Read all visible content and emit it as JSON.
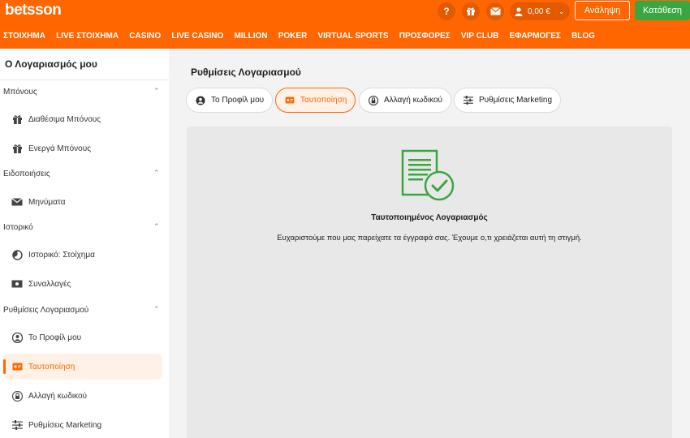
{
  "header": {
    "logo": "betsson",
    "help_icon": "?",
    "balance": "0,00 €",
    "login_label": "Ανάληψη",
    "register_label": "Κατάθεση"
  },
  "nav": [
    "ΣΤΟΙΧΗΜΑ",
    "LIVE ΣΤΟΙΧΗΜΑ",
    "CASINO",
    "LIVE CASINO",
    "MILLION",
    "POKER",
    "VIRTUAL SPORTS",
    "ΠΡΟΣΦΟΡΕΣ",
    "VIP CLUB",
    "ΕΦΑΡΜΟΓΕΣ",
    "BLOG"
  ],
  "sidebar": {
    "title": "Ο Λογαριασμός μου",
    "sections": [
      {
        "label": "Μπόνους",
        "items": [
          {
            "label": "Διαθέσιμα Μπόνους",
            "icon": "gift-icon"
          },
          {
            "label": "Ενεργά Μπόνους",
            "icon": "gift-icon"
          }
        ]
      },
      {
        "label": "Ειδοποιήσεις",
        "items": [
          {
            "label": "Μηνύματα",
            "icon": "envelope-icon"
          }
        ]
      },
      {
        "label": "Ιστορικό",
        "items": [
          {
            "label": "Ιστορικό: Στοίχημα",
            "icon": "history-icon"
          },
          {
            "label": "Συναλλαγές",
            "icon": "money-icon"
          }
        ]
      },
      {
        "label": "Ρυθμίσεις Λογαριασμού",
        "items": [
          {
            "label": "Το Προφίλ μου",
            "icon": "user-icon"
          },
          {
            "label": "Ταυτοποίηση",
            "icon": "id-card-icon",
            "active": true
          },
          {
            "label": "Αλλαγή κωδικού",
            "icon": "lock-icon"
          },
          {
            "label": "Ρυθμίσεις Marketing",
            "icon": "sliders-icon"
          }
        ]
      }
    ]
  },
  "main": {
    "title": "Ρυθμίσεις Λογαριασμού",
    "tabs": [
      {
        "label": "Το Προφίλ μου",
        "icon": "user-icon"
      },
      {
        "label": "Ταυτοποίηση",
        "icon": "id-card-icon",
        "active": true
      },
      {
        "label": "Αλλαγή κωδικού",
        "icon": "lock-icon"
      },
      {
        "label": "Ρυθμίσεις Marketing",
        "icon": "sliders-icon"
      }
    ],
    "verified_heading": "Ταυτοποιημένος Λογαριασμός",
    "verified_text": "Ευχαριστούμε που μας παρείχατε τα έγγραφά σας. Έχουμε ο,τι χρειάζεται αυτή τη στιγμή."
  },
  "colors": {
    "brand": "#ff6600",
    "success": "#3aa641"
  }
}
